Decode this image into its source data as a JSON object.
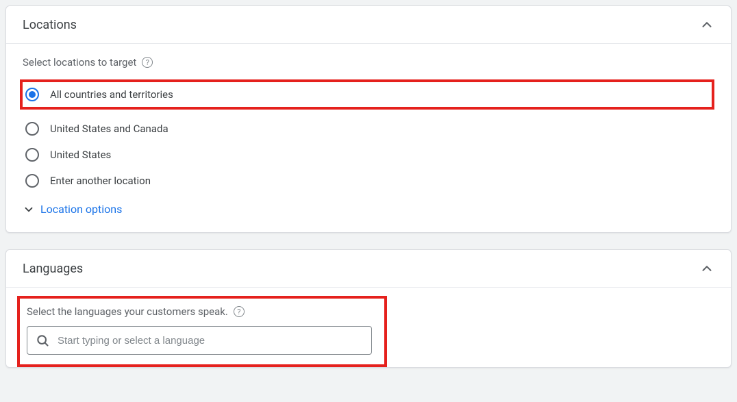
{
  "locations": {
    "title": "Locations",
    "subhead": "Select locations to target",
    "options": {
      "all": "All countries and territories",
      "us_canada": "United States and Canada",
      "us": "United States",
      "another": "Enter another location"
    },
    "location_options_label": "Location options"
  },
  "languages": {
    "title": "Languages",
    "subhead": "Select the languages your customers speak.",
    "search_placeholder": "Start typing or select a language"
  }
}
